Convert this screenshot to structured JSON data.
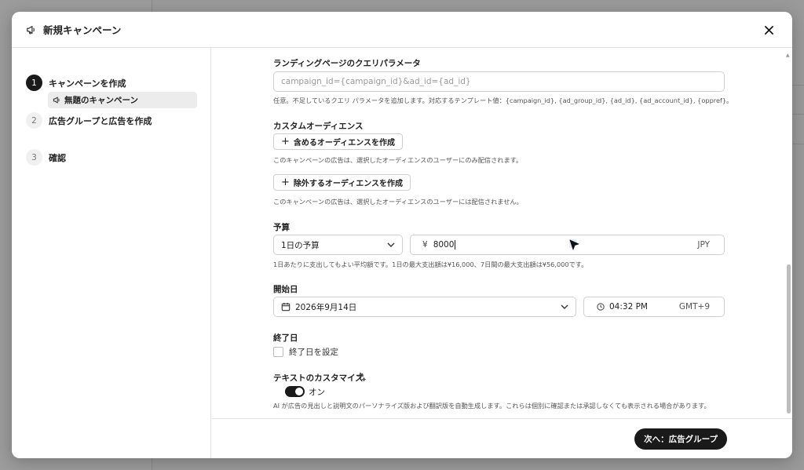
{
  "modal": {
    "title": "新規キャンペーン"
  },
  "steps": [
    {
      "num": "1",
      "label": "キャンペーンを作成",
      "active": true
    },
    {
      "num": "2",
      "label": "広告グループと広告を作成",
      "active": false
    },
    {
      "num": "3",
      "label": "確認",
      "active": false
    }
  ],
  "substep": {
    "label": "無題のキャンペーン"
  },
  "query_params": {
    "label": "ランディングページのクエリパラメータ",
    "placeholder": "campaign_id={campaign_id}&ad_id={ad_id}",
    "help": "任意。不足しているクエリ パラメータを追加します。対応するテンプレート値：{campaign_id}, {ad_group_id}, {ad_id}, {ad_account_id}, {oppref}。"
  },
  "custom_audience": {
    "label": "カスタムオーディエンス",
    "include_button": "含めるオーディエンスを作成",
    "include_help": "このキャンペーンの広告は、選択したオーディエンスのユーザーにのみ配信されます。",
    "exclude_button": "除外するオーディエンスを作成",
    "exclude_help": "このキャンペーンの広告は、選択したオーディエンスのユーザーには配信されません。"
  },
  "budget": {
    "label": "予算",
    "type_value": "1日の予算",
    "currency_symbol": "¥",
    "amount": "8000",
    "currency": "JPY",
    "help": "1日あたりに支出してもよい平均額です。1日の最大支出額は¥16,000、7日間の最大支出額は¥56,000です。"
  },
  "start_date": {
    "label": "開始日",
    "date": "2026年9月14日",
    "time": "04:32 PM",
    "timezone": "GMT+9"
  },
  "end_date": {
    "label": "終了日",
    "checkbox_label": "終了日を設定"
  },
  "text_customize": {
    "label": "テキストのカスタマイズ",
    "toggle_label": "オン",
    "help": "AI が広告の見出しと説明文のパーソナライズ版および翻訳版を自動生成します。これらは個別に確認または承認しなくても表示される場合があります。"
  },
  "footer": {
    "next_button": "次へ：広告グループ"
  },
  "icons": {
    "header": "megaphone-icon",
    "close": "close-icon",
    "calendar": "calendar-icon",
    "clock": "clock-icon",
    "sparkle": "sparkle-icon"
  }
}
